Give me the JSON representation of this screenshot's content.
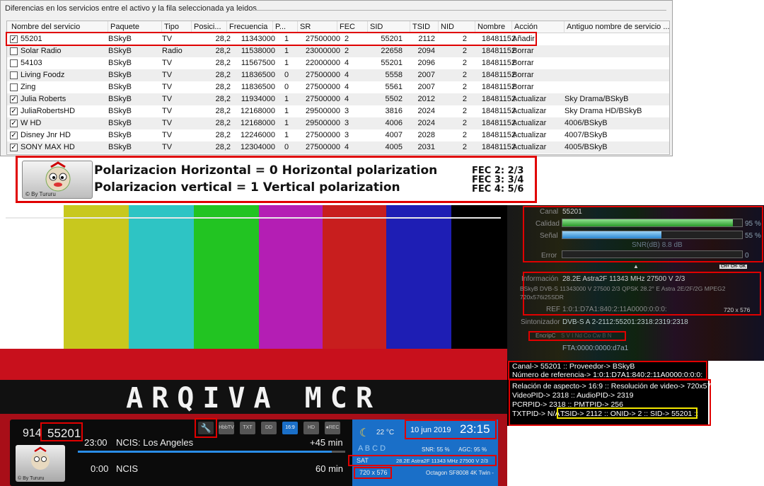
{
  "group": {
    "title": "Diferencias en los servicios entre el activo y la fila seleccionada ya leidos"
  },
  "table": {
    "columns": [
      "Nombre del servicio",
      "Paquete",
      "Tipo",
      "Posici...",
      "Frecuencia",
      "P...",
      "SR",
      "FEC",
      "SID",
      "TSID",
      "NID",
      "Nombre",
      "Acción",
      "Antiguo nombre de servicio ..."
    ],
    "rows": [
      {
        "checked": true,
        "cells": [
          "55201",
          "BSkyB",
          "TV",
          "28,2",
          "11343000",
          "1",
          "27500000",
          "2",
          "55201",
          "2112",
          "2",
          "18481152",
          "Añadir",
          ""
        ]
      },
      {
        "checked": false,
        "cells": [
          "Solar Radio",
          "BSkyB",
          "Radio",
          "28,2",
          "11538000",
          "1",
          "23000000",
          "2",
          "22658",
          "2094",
          "2",
          "18481152",
          "Borrar",
          ""
        ]
      },
      {
        "checked": false,
        "cells": [
          "54103",
          "BSkyB",
          "TV",
          "28,2",
          "11567500",
          "1",
          "22000000",
          "4",
          "55201",
          "2096",
          "2",
          "18481152",
          "Borrar",
          ""
        ]
      },
      {
        "checked": false,
        "cells": [
          "Living Foodz",
          "BSkyB",
          "TV",
          "28,2",
          "11836500",
          "0",
          "27500000",
          "4",
          "5558",
          "2007",
          "2",
          "18481152",
          "Borrar",
          ""
        ]
      },
      {
        "checked": false,
        "cells": [
          "Zing",
          "BSkyB",
          "TV",
          "28,2",
          "11836500",
          "0",
          "27500000",
          "4",
          "5561",
          "2007",
          "2",
          "18481152",
          "Borrar",
          ""
        ]
      },
      {
        "checked": true,
        "cells": [
          "Julia Roberts",
          "BSkyB",
          "TV",
          "28,2",
          "11934000",
          "1",
          "27500000",
          "4",
          "5502",
          "2012",
          "2",
          "18481152",
          "Actualizar",
          "Sky Drama/BSkyB"
        ]
      },
      {
        "checked": true,
        "cells": [
          "JuliaRobertsHD",
          "BSkyB",
          "TV",
          "28,2",
          "12168000",
          "1",
          "29500000",
          "3",
          "3816",
          "2024",
          "2",
          "18481152",
          "Actualizar",
          "Sky Drama HD/BSkyB"
        ]
      },
      {
        "checked": true,
        "cells": [
          "W HD",
          "BSkyB",
          "TV",
          "28,2",
          "12168000",
          "1",
          "29500000",
          "3",
          "4006",
          "2024",
          "2",
          "18481152",
          "Actualizar",
          "4006/BSkyB"
        ]
      },
      {
        "checked": true,
        "cells": [
          "Disney Jnr HD",
          "BSkyB",
          "TV",
          "28,2",
          "12246000",
          "1",
          "27500000",
          "3",
          "4007",
          "2028",
          "2",
          "18481152",
          "Actualizar",
          "4007/BSkyB"
        ]
      },
      {
        "checked": true,
        "cells": [
          "SONY MAX HD",
          "BSkyB",
          "TV",
          "28,2",
          "12304000",
          "0",
          "27500000",
          "4",
          "4005",
          "2031",
          "2",
          "18481152",
          "Actualizar",
          "4005/BSkyB"
        ]
      }
    ]
  },
  "legend": {
    "line1": "Polarizacion  Horizontal = 0  Horizontal polarization",
    "line2": "Polarizacion  vertical      = 1  Vertical polarization",
    "fec": [
      "FEC 2: 2/3",
      "FEC 3: 3/4",
      "FEC 4: 5/6"
    ],
    "by": "© By Tururu"
  },
  "tv": {
    "bar_colors": [
      "#ffffff",
      "#c8c81e",
      "#2ec4c4",
      "#22c422",
      "#b41eb4",
      "#c81e1e",
      "#1e1eb4",
      "#000000"
    ],
    "title": "ARQIVA MCR",
    "channel_num": "914",
    "channel_id": "55201",
    "prog1_time": "23:00",
    "prog1_title": "NCIS: Los Angeles",
    "prog1_remain": "+45 min",
    "prog1_progress": 0.95,
    "prog2_time": "0:00",
    "prog2_title": "NCIS",
    "prog2_remain": "60 min",
    "temp": "22 °C",
    "date": "10 jun 2019",
    "time": "23:15",
    "abcd": "A B C D",
    "snr": "SNR:  55 %",
    "agc": "AGC:  95 %",
    "sat_label": "SAT",
    "sat_info": "28.2E Astra2F 11343 MHz 27500 V 2/3",
    "resolution": "720 x 576",
    "receiver": "Octagon SF8008 4K Twin -",
    "by": "© By Tururu",
    "icons": [
      "HbbTV",
      "TXT",
      "DD",
      "16:9",
      "HD",
      "●REC"
    ]
  },
  "panel": {
    "canal_label": "Canal",
    "canal_value": "55201",
    "calidad_label": "Calidad",
    "calidad_pct": "95 %",
    "calidad_level": 0.95,
    "senal_label": "Señal",
    "senal_pct": "55 %",
    "senal_level": 0.55,
    "snr": "SNR(dB) 8.8 dB",
    "error_label": "Error",
    "error_value": "0",
    "buttons": "CH+ CH- OK",
    "info_label": "Información",
    "info_value": "28.2E Astra2F 11343 MHz 27500 V 2/3",
    "info_line2": "BSkyB  DVB-S  11343000  V  27500  2/3  QPSK  28.2° E  Astra 2E/2F/2G  MPEG2",
    "info_line3": "720x576i25SDR",
    "ref_label": "REF",
    "ref_value": "1:0:1:D7A1:840:2:11A0000:0:0:0:",
    "ref_res": "720 x 576",
    "sint_label": "Sintonizador",
    "sint_value": "DVB-S   A   2-2112:55201:2318:2319:2318",
    "encript_label": "EncripC",
    "encript_value": "S V I Nd Co Cw B N",
    "fta": "FTA:0000:0000:d7a1"
  },
  "info2": {
    "l1": "Canal-> 55201 :: Proveedor-> BSkyB",
    "l2": "Número de referencia-> 1:0:1:D7A1:840:2:11A0000:0:0:0:",
    "l3": "Relación de aspecto-> 16:9 :: Resolución de video-> 720x576",
    "l4": "VideoPID-> 2318 :: AudioPID-> 2319",
    "l5": "PCRPID-> 2318 :: PMTPID-> 256",
    "l6a": "TXTPID-> N/A ::",
    "l6b": "TSID-> 2112 :: ONID-> 2 :: SID-> 55201 ::"
  }
}
